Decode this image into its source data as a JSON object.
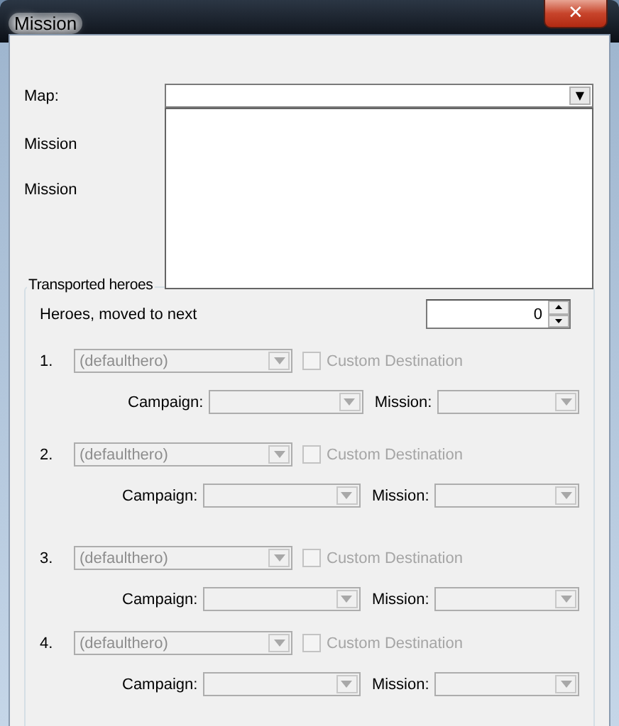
{
  "window": {
    "title": "Mission",
    "close_symbol": "✕"
  },
  "map": {
    "label": "Map:",
    "expanded": true,
    "arrow": "▼"
  },
  "mission_labels": [
    "Mission",
    "Mission"
  ],
  "transported": {
    "title": "Transported heroes",
    "count_label": "Heroes, moved to next",
    "count_value": "0"
  },
  "heroes": [
    {
      "number": "1.",
      "hero": "(defaulthero)",
      "disabled": true,
      "custom_label": "Custom Destination",
      "custom_checked": false,
      "campaign_label": "Campaign:",
      "mission_label": "Mission:"
    },
    {
      "number": "2.",
      "hero": "(defaulthero)",
      "disabled": true,
      "custom_label": "Custom Destination",
      "custom_checked": false,
      "campaign_label": "Campaign:",
      "mission_label": "Mission:"
    },
    {
      "number": "3.",
      "hero": "(defaulthero)",
      "disabled": true,
      "custom_label": "Custom Destination",
      "custom_checked": false,
      "campaign_label": "Campaign:",
      "mission_label": "Mission:"
    },
    {
      "number": "4.",
      "hero": "(defaulthero)",
      "disabled": true,
      "custom_label": "Custom Destination",
      "custom_checked": false,
      "campaign_label": "Campaign:",
      "mission_label": "Mission:"
    }
  ]
}
